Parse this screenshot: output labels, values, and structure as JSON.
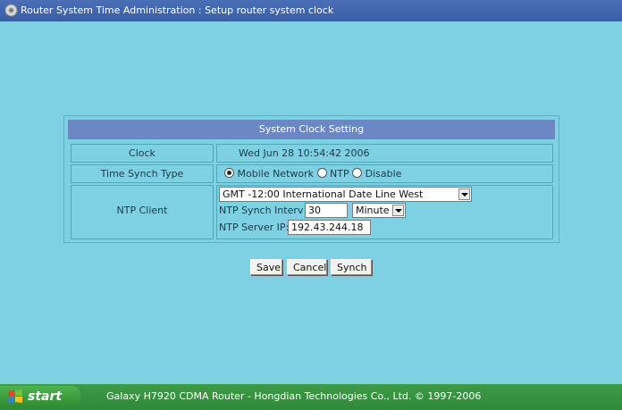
{
  "window": {
    "title": "Router System Time Administration : Setup router system clock"
  },
  "panel": {
    "header": "System Clock Setting",
    "clock": {
      "label": "Clock",
      "value": "Wed Jun 28 10:54:42 2006"
    },
    "time_synch_type": {
      "label": "Time Synch Type",
      "options": [
        "Mobile Network",
        "NTP",
        "Disable"
      ],
      "selected": "Mobile Network"
    },
    "ntp_client": {
      "label": "NTP Client",
      "timezone_selected": "GMT -12:00 International Date Line West",
      "synch_interval_label": "NTP Synch Interval",
      "synch_interval_value": "30",
      "interval_unit_selected": "Minute",
      "server_ip_label": "NTP Server IP:",
      "server_ip_value": "192.43.244.18"
    }
  },
  "buttons": {
    "save": "Save",
    "cancel": "Cancel",
    "synch": "Synch"
  },
  "taskbar": {
    "start_label": "start",
    "footer": "Galaxy H7920 CDMA Router - Hongdian Technologies Co., Ltd. © 1997-2006"
  },
  "colors": {
    "background": "#7dd1e2",
    "titlebar": "#3f64ac",
    "panel_header": "#6c88c4",
    "taskbar": "#2e8a38"
  }
}
